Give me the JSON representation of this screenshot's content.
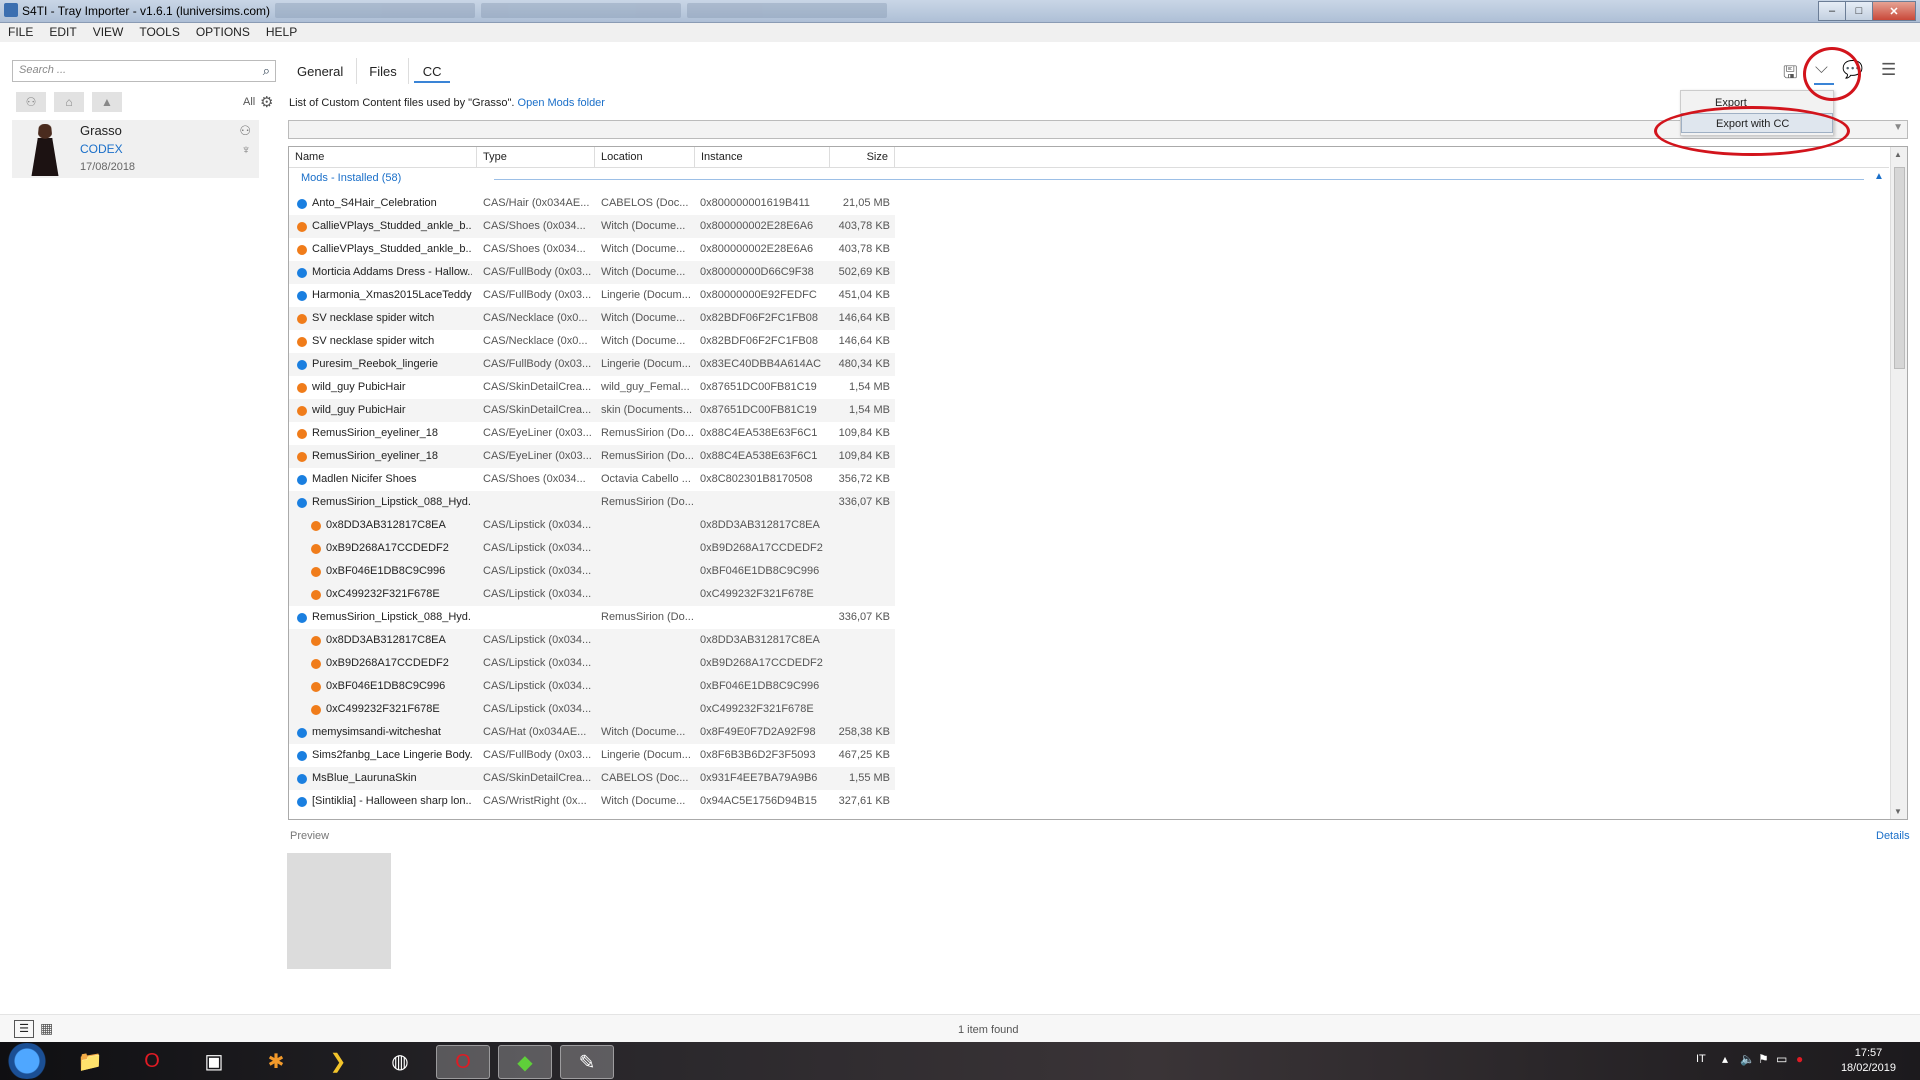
{
  "window": {
    "title": "S4TI - Tray Importer - v1.6.1  (luniversims.com)"
  },
  "menubar": [
    "FILE",
    "EDIT",
    "VIEW",
    "TOOLS",
    "OPTIONS",
    "HELP"
  ],
  "sidebar": {
    "search_placeholder": "Search ...",
    "all_label": "All",
    "household": {
      "name": "Grasso",
      "tag": "CODEX",
      "date": "17/08/2018"
    }
  },
  "tabs": [
    "General",
    "Files",
    "CC"
  ],
  "active_tab": "CC",
  "subtitle": {
    "text": "List of Custom Content files used by \"Grasso\".",
    "link": "Open Mods folder"
  },
  "dropdown": {
    "items": [
      "Export",
      "Export with CC"
    ],
    "selected": "Export with CC"
  },
  "table": {
    "columns": [
      "Name",
      "Type",
      "Location",
      "Instance",
      "Size"
    ],
    "group_label": "Mods - Installed  (58)",
    "rows": [
      {
        "name": "Anto_S4Hair_Celebration",
        "type": "CAS/Hair (0x034AE...",
        "location": "CABELOS (Doc...",
        "instance": "0x800000001619B411",
        "size": "21,05 MB",
        "dot": "blue",
        "sub": false
      },
      {
        "name": "CallieVPlays_Studded_ankle_b...",
        "type": "CAS/Shoes (0x034...",
        "location": "Witch (Docume...",
        "instance": "0x800000002E28E6A6",
        "size": "403,78 KB",
        "dot": "orange",
        "sub": false
      },
      {
        "name": "CallieVPlays_Studded_ankle_b...",
        "type": "CAS/Shoes (0x034...",
        "location": "Witch (Docume...",
        "instance": "0x800000002E28E6A6",
        "size": "403,78 KB",
        "dot": "orange",
        "sub": false
      },
      {
        "name": "Morticia Addams Dress - Hallow...",
        "type": "CAS/FullBody (0x03...",
        "location": "Witch (Docume...",
        "instance": "0x80000000D66C9F38",
        "size": "502,69 KB",
        "dot": "blue",
        "sub": false
      },
      {
        "name": "Harmonia_Xmas2015LaceTeddy",
        "type": "CAS/FullBody (0x03...",
        "location": "Lingerie (Docum...",
        "instance": "0x80000000E92FEDFC",
        "size": "451,04 KB",
        "dot": "blue",
        "sub": false
      },
      {
        "name": "SV necklase spider witch",
        "type": "CAS/Necklace (0x0...",
        "location": "Witch (Docume...",
        "instance": "0x82BDF06F2FC1FB08",
        "size": "146,64 KB",
        "dot": "orange",
        "sub": false
      },
      {
        "name": "SV necklase spider witch",
        "type": "CAS/Necklace (0x0...",
        "location": "Witch (Docume...",
        "instance": "0x82BDF06F2FC1FB08",
        "size": "146,64 KB",
        "dot": "orange",
        "sub": false
      },
      {
        "name": "Puresim_Reebok_lingerie",
        "type": "CAS/FullBody (0x03...",
        "location": "Lingerie (Docum...",
        "instance": "0x83EC40DBB4A614AC",
        "size": "480,34 KB",
        "dot": "blue",
        "sub": false
      },
      {
        "name": "wild_guy PubicHair",
        "type": "CAS/SkinDetailCrea...",
        "location": "wild_guy_Femal...",
        "instance": "0x87651DC00FB81C19",
        "size": "1,54 MB",
        "dot": "orange",
        "sub": false
      },
      {
        "name": "wild_guy PubicHair",
        "type": "CAS/SkinDetailCrea...",
        "location": "skin (Documents...",
        "instance": "0x87651DC00FB81C19",
        "size": "1,54 MB",
        "dot": "orange",
        "sub": false
      },
      {
        "name": "RemusSirion_eyeliner_18",
        "type": "CAS/EyeLiner (0x03...",
        "location": "RemusSirion (Do...",
        "instance": "0x88C4EA538E63F6C1",
        "size": "109,84 KB",
        "dot": "orange",
        "sub": false
      },
      {
        "name": "RemusSirion_eyeliner_18",
        "type": "CAS/EyeLiner (0x03...",
        "location": "RemusSirion (Do...",
        "instance": "0x88C4EA538E63F6C1",
        "size": "109,84 KB",
        "dot": "orange",
        "sub": false
      },
      {
        "name": "Madlen Nicifer Shoes",
        "type": "CAS/Shoes (0x034...",
        "location": "Octavia Cabello ...",
        "instance": "0x8C802301B8170508",
        "size": "356,72 KB",
        "dot": "blue",
        "sub": false
      },
      {
        "name": "RemusSirion_Lipstick_088_Hyd...",
        "type": "",
        "location": "RemusSirion (Do...",
        "instance": "",
        "size": "336,07 KB",
        "dot": "blue",
        "sub": false
      },
      {
        "name": "0x8DD3AB312817C8EA",
        "type": "CAS/Lipstick (0x034...",
        "location": "",
        "instance": "0x8DD3AB312817C8EA",
        "size": "",
        "dot": "orange",
        "sub": true
      },
      {
        "name": "0xB9D268A17CCDEDF2",
        "type": "CAS/Lipstick (0x034...",
        "location": "",
        "instance": "0xB9D268A17CCDEDF2",
        "size": "",
        "dot": "orange",
        "sub": true
      },
      {
        "name": "0xBF046E1DB8C9C996",
        "type": "CAS/Lipstick (0x034...",
        "location": "",
        "instance": "0xBF046E1DB8C9C996",
        "size": "",
        "dot": "orange",
        "sub": true
      },
      {
        "name": "0xC499232F321F678E",
        "type": "CAS/Lipstick (0x034...",
        "location": "",
        "instance": "0xC499232F321F678E",
        "size": "",
        "dot": "orange",
        "sub": true
      },
      {
        "name": "RemusSirion_Lipstick_088_Hyd...",
        "type": "",
        "location": "RemusSirion (Do...",
        "instance": "",
        "size": "336,07 KB",
        "dot": "blue",
        "sub": false
      },
      {
        "name": "0x8DD3AB312817C8EA",
        "type": "CAS/Lipstick (0x034...",
        "location": "",
        "instance": "0x8DD3AB312817C8EA",
        "size": "",
        "dot": "orange",
        "sub": true
      },
      {
        "name": "0xB9D268A17CCDEDF2",
        "type": "CAS/Lipstick (0x034...",
        "location": "",
        "instance": "0xB9D268A17CCDEDF2",
        "size": "",
        "dot": "orange",
        "sub": true
      },
      {
        "name": "0xBF046E1DB8C9C996",
        "type": "CAS/Lipstick (0x034...",
        "location": "",
        "instance": "0xBF046E1DB8C9C996",
        "size": "",
        "dot": "orange",
        "sub": true
      },
      {
        "name": "0xC499232F321F678E",
        "type": "CAS/Lipstick (0x034...",
        "location": "",
        "instance": "0xC499232F321F678E",
        "size": "",
        "dot": "orange",
        "sub": true
      },
      {
        "name": "memysimsandi-witcheshat",
        "type": "CAS/Hat (0x034AE...",
        "location": "Witch (Docume...",
        "instance": "0x8F49E0F7D2A92F98",
        "size": "258,38 KB",
        "dot": "blue",
        "sub": false
      },
      {
        "name": "Sims2fanbg_Lace Lingerie Body...",
        "type": "CAS/FullBody (0x03...",
        "location": "Lingerie (Docum...",
        "instance": "0x8F6B3B6D2F3F5093",
        "size": "467,25 KB",
        "dot": "blue",
        "sub": false
      },
      {
        "name": "MsBlue_LaurunaSkin",
        "type": "CAS/SkinDetailCrea...",
        "location": "CABELOS (Doc...",
        "instance": "0x931F4EE7BA79A9B6",
        "size": "1,55 MB",
        "dot": "blue",
        "sub": false
      },
      {
        "name": "[Sintiklia] - Halloween sharp lon...",
        "type": "CAS/WristRight (0x...",
        "location": "Witch (Docume...",
        "instance": "0x94AC5E1756D94B15",
        "size": "327,61 KB",
        "dot": "blue",
        "sub": false
      }
    ]
  },
  "preview_label": "Preview",
  "details_label": "Details",
  "status": {
    "count": "1 item found"
  },
  "taskbar": {
    "lang": "IT",
    "time": "17:57",
    "date": "18/02/2019"
  },
  "colors": {
    "blue_dot": "#1a7fe0",
    "orange_dot": "#f07c1a",
    "link": "#1a6fc9",
    "annotation_red": "#d2141c"
  }
}
